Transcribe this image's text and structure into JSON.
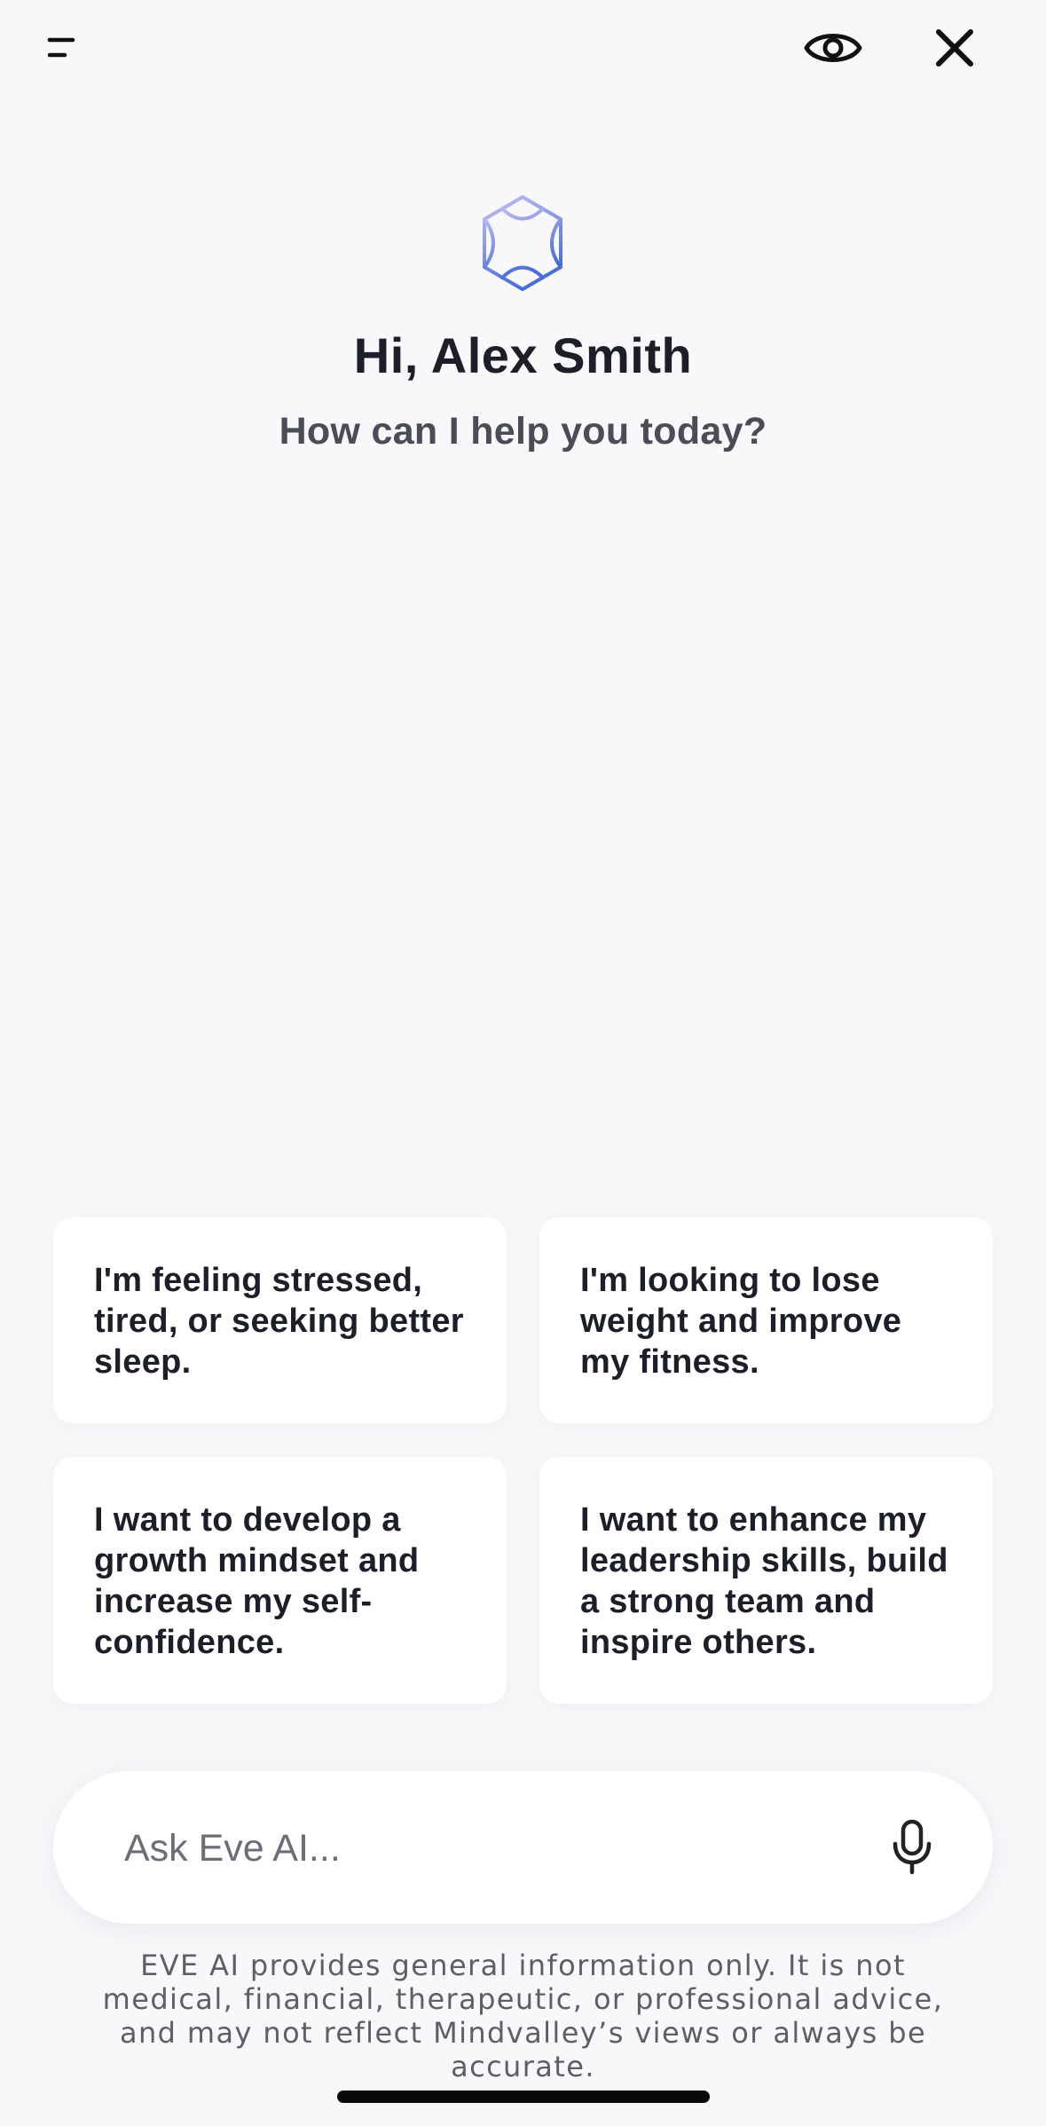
{
  "header": {
    "menu_icon": "menu-icon",
    "eye_icon": "eye-icon",
    "close_icon": "close-icon"
  },
  "hero": {
    "logo_icon": "eve-logo-icon",
    "greeting": "Hi, Alex Smith",
    "subtitle": "How can I help you today?"
  },
  "suggestions": [
    {
      "text": "I'm feeling stressed, tired, or seeking better sleep."
    },
    {
      "text": "I'm looking to lose weight and improve my fitness."
    },
    {
      "text": "I want to develop a growth mindset and increase my self-confidence."
    },
    {
      "text": "I want to enhance my leadership skills, build a strong team and inspire others."
    }
  ],
  "input": {
    "placeholder": "Ask Eve AI...",
    "value": "",
    "mic_icon": "microphone-icon"
  },
  "disclaimer": "EVE AI provides general information only. It is not medical, financial, therapeutic, or professional advice, and may not reflect Mindvalley’s views or always be accurate.",
  "colors": {
    "background": "#f8f7f9",
    "text_primary": "#1c1f2a",
    "text_secondary": "#4a4c57",
    "logo_gradient_start": "#b7b5f2",
    "logo_gradient_end": "#4a6ed8"
  }
}
